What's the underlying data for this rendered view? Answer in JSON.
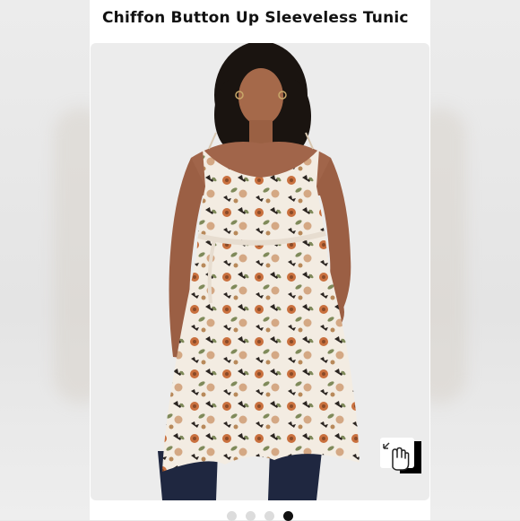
{
  "listing": {
    "title": "Chiffon Button Up Sleeveless Tunic"
  },
  "photo": {
    "background": "#ececec",
    "dress_base": "#f3ece2",
    "print_colors": [
      "#c9703e",
      "#b8895a",
      "#2b2521",
      "#7f8a5a",
      "#d4a884"
    ],
    "jeans": "#1f2740"
  },
  "zoom_icon": "pointer-hand-zoom-icon",
  "carousel": {
    "count": 4,
    "active_index": 3
  }
}
